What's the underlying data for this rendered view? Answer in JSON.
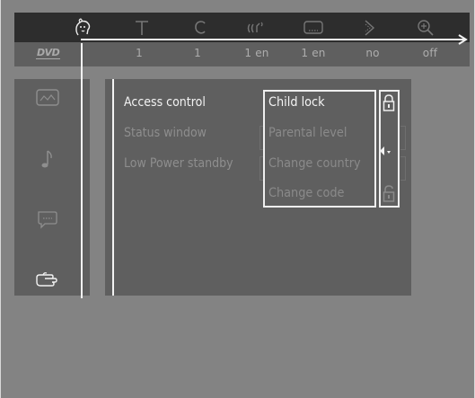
{
  "colors": {
    "background": "#838383",
    "top_bar": "#2d2d2d",
    "panel": "#5f5f5f",
    "highlight": "#f2f2f2",
    "dim_text": "#8e8e8e"
  },
  "top_bar": {
    "icons": [
      {
        "name": "person-face-icon",
        "selected": true
      },
      {
        "name": "subtitle-t-icon",
        "selected": false
      },
      {
        "name": "chapter-c-icon",
        "selected": false
      },
      {
        "name": "audio-waves-icon",
        "selected": false
      },
      {
        "name": "subtitle-bubble-icon",
        "selected": false
      },
      {
        "name": "angle-arrow-icon",
        "selected": false
      },
      {
        "name": "zoom-magnifier-icon",
        "selected": false
      }
    ]
  },
  "sub_bar": {
    "logo": "DVD",
    "values": [
      "1",
      "1",
      "1 en",
      "1 en",
      "no",
      "off"
    ]
  },
  "side_menu": {
    "icons": [
      {
        "name": "picture-settings-icon",
        "selected": false
      },
      {
        "name": "music-note-icon",
        "selected": false
      },
      {
        "name": "language-speech-icon",
        "selected": false
      },
      {
        "name": "features-hand-icon",
        "selected": true
      }
    ]
  },
  "main_menu": {
    "items": [
      {
        "label": "Access control",
        "active": true
      },
      {
        "label": "Status window",
        "active": false
      },
      {
        "label": "Low Power standby",
        "active": false
      }
    ]
  },
  "submenu": {
    "items": [
      {
        "label": "Child lock",
        "active": true
      },
      {
        "label": "Parental level",
        "active": false
      },
      {
        "label": "Change country",
        "active": false
      },
      {
        "label": "Change code",
        "active": false
      }
    ]
  },
  "lock_column": {
    "top_icon": "lock-closed-icon",
    "bottom_icon": "lock-open-icon",
    "pointer": "triangle-pointer-icon"
  }
}
